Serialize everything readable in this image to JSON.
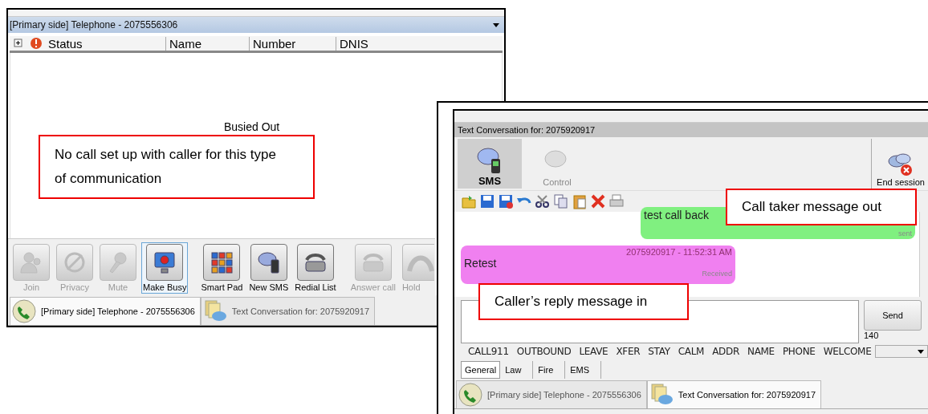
{
  "telephone_window": {
    "title": "[Primary side] Telephone - 2075556306",
    "columns": [
      {
        "label": "Status"
      },
      {
        "label": "Name"
      },
      {
        "label": "Number"
      },
      {
        "label": "DNIS"
      }
    ],
    "status_text": "Busied Out",
    "toolbar": [
      {
        "label": "Join",
        "disabled": true,
        "selected": false
      },
      {
        "label": "Privacy",
        "disabled": true,
        "selected": false
      },
      {
        "label": "Mute",
        "disabled": true,
        "selected": false
      },
      {
        "label": "Make Busy",
        "disabled": false,
        "selected": true
      },
      {
        "label": "Smart Pad",
        "disabled": false,
        "selected": false
      },
      {
        "label": "New SMS",
        "disabled": false,
        "selected": false
      },
      {
        "label": "Redial List",
        "disabled": false,
        "selected": false
      },
      {
        "label": "Answer call",
        "disabled": true,
        "selected": false
      },
      {
        "label": "Hold",
        "disabled": true,
        "selected": false
      }
    ],
    "tabs": [
      {
        "label": "[Primary side] Telephone - 2075556306",
        "selected": true
      },
      {
        "label": "Text Conversation for: 2075920917",
        "selected": false
      }
    ]
  },
  "text_window": {
    "title": "Text Conversation for: 2075920917",
    "modes": [
      {
        "label": "SMS",
        "selected": true,
        "disabled": false
      },
      {
        "label": "Control",
        "selected": false,
        "disabled": true
      }
    ],
    "end_session": "End session",
    "messages": [
      {
        "kind": "sent",
        "text": "test call back",
        "status": "sent"
      },
      {
        "kind": "received",
        "header": "2075920917 - 11:52:31 AM",
        "text": "Retest",
        "status": "Received"
      }
    ],
    "send": "Send",
    "char_count": "140",
    "quick_texts": [
      "CALL911",
      "OUTBOUND",
      "LEAVE",
      "XFER",
      "STAY",
      "CALM",
      "ADDR",
      "NAME",
      "PHONE",
      "WELCOME"
    ],
    "categories": [
      {
        "label": "General",
        "selected": true
      },
      {
        "label": "Law",
        "selected": false
      },
      {
        "label": "Fire",
        "selected": false
      },
      {
        "label": "EMS",
        "selected": false
      }
    ],
    "tabs": [
      {
        "label": "[Primary side] Telephone - 2075556306",
        "selected": false
      },
      {
        "label": "Text Conversation for: 2075920917",
        "selected": true
      }
    ]
  },
  "callouts": [
    "No call set up with caller for this type of communication",
    "Call taker message out",
    "Caller’s reply message in"
  ]
}
